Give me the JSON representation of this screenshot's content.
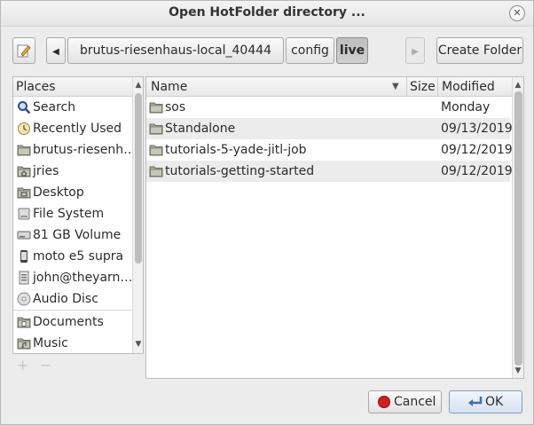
{
  "window": {
    "title": "Open HotFolder directory ..."
  },
  "pathbar": {
    "segments": [
      "brutus-riesenhaus-local_40444",
      "config",
      "live"
    ],
    "create_folder_label": "Create Folder"
  },
  "places": {
    "header": "Places",
    "items": [
      {
        "label": "Search",
        "icon": "search-icon"
      },
      {
        "label": "Recently Used",
        "icon": "recent-icon"
      },
      {
        "label": "brutus-riesenh…",
        "icon": "folder-icon"
      },
      {
        "label": "jries",
        "icon": "home-folder-icon"
      },
      {
        "label": "Desktop",
        "icon": "desktop-folder-icon"
      },
      {
        "label": "File System",
        "icon": "filesystem-icon"
      },
      {
        "label": "81 GB Volume",
        "icon": "drive-icon"
      },
      {
        "label": "moto e5 supra",
        "icon": "phone-icon"
      },
      {
        "label": "john@theyarn…",
        "icon": "network-icon"
      },
      {
        "label": "Audio Disc",
        "icon": "disc-icon"
      },
      {
        "label": "Documents",
        "icon": "documents-folder-icon"
      },
      {
        "label": "Music",
        "icon": "music-folder-icon"
      }
    ],
    "add_label": "+",
    "remove_label": "−"
  },
  "files": {
    "columns": {
      "name": "Name",
      "size": "Size",
      "modified": "Modified"
    },
    "rows": [
      {
        "name": "sos",
        "size": "",
        "modified": "Monday"
      },
      {
        "name": "Standalone",
        "size": "",
        "modified": "09/13/2019"
      },
      {
        "name": "tutorials-5-yade-jitl-job",
        "size": "",
        "modified": "09/12/2019"
      },
      {
        "name": "tutorials-getting-started",
        "size": "",
        "modified": "09/12/2019"
      }
    ]
  },
  "footer": {
    "cancel_label": "Cancel",
    "ok_label": "OK"
  },
  "colors": {
    "folder": "#a8aa9a",
    "cancel_icon": "#d21f1f",
    "ok_icon": "#3c6fb0"
  }
}
